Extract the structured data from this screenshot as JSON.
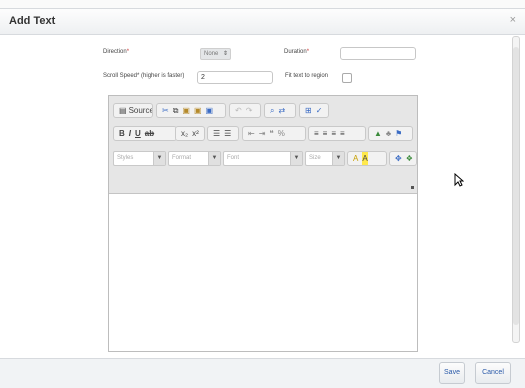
{
  "dialog": {
    "title": "Add Text",
    "close_icon": "x-icon"
  },
  "form": {
    "direction_label": "Direction",
    "direction_value": "None",
    "duration_label": "Duration",
    "duration_value": "",
    "scroll_speed_label": "Scroll Speed* (higher is faster)",
    "scroll_speed_value": "2",
    "fit_text_label": "Fit text to region",
    "fit_text_checked": false
  },
  "editor": {
    "source_label": "Source",
    "row1_icons": [
      "cut-icon",
      "copy-icon",
      "paste-icon",
      "paste-text-icon",
      "paste-word-icon",
      "undo-icon",
      "redo-icon",
      "find-icon",
      "replace-icon",
      "select-all-icon",
      "spellcheck-icon"
    ],
    "row2_icons": [
      "bold-icon",
      "italic-icon",
      "underline-icon",
      "strike-icon",
      "subscript-icon",
      "superscript-icon",
      "numbered-list-icon",
      "bulleted-list-icon",
      "outdent-icon",
      "indent-icon",
      "blockquote-icon",
      "div-icon",
      "align-left-icon",
      "align-center-icon",
      "align-right-icon",
      "justify-icon",
      "image-icon",
      "flash-icon",
      "flag-icon"
    ],
    "styles_placeholder": "Styles",
    "format_placeholder": "Format",
    "font_placeholder": "Font",
    "size_placeholder": "Size",
    "row3_icons": [
      "text-color-icon",
      "bg-color-icon",
      "maximize-icon",
      "show-blocks-icon",
      "about-icon"
    ],
    "body_text": ""
  },
  "footer": {
    "save_label": "Save",
    "cancel_label": "Cancel"
  }
}
